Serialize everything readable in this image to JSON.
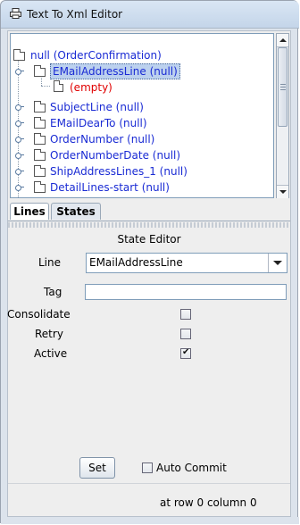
{
  "window": {
    "title": "Text To Xml Editor",
    "icon": "printer-icon"
  },
  "tree": {
    "root_label": "null (OrderConfirmation)",
    "nodes": [
      {
        "label": "EMailAddressLine (null)",
        "selected": true,
        "icon": "folder-icon"
      },
      {
        "label": "(empty)",
        "icon": "document-icon",
        "color": "#e00000"
      },
      {
        "label": "SubjectLine (null)",
        "icon": "folder-icon"
      },
      {
        "label": "EMailDearTo (null)",
        "icon": "folder-icon"
      },
      {
        "label": "OrderNumber (null)",
        "icon": "folder-icon"
      },
      {
        "label": "OrderNumberDate (null)",
        "icon": "folder-icon"
      },
      {
        "label": "ShipAddressLines_1 (null)",
        "icon": "folder-icon"
      },
      {
        "label": "DetailLines-start (null)",
        "icon": "folder-icon"
      }
    ]
  },
  "tabs": [
    {
      "label": "Lines",
      "active": true
    },
    {
      "label": "States",
      "active": false
    }
  ],
  "state_editor": {
    "title": "State Editor",
    "line_label": "Line",
    "line_value": "EMailAddressLine",
    "tag_label": "Tag",
    "tag_value": "",
    "consolidate_label": "Consolidate",
    "consolidate_checked": false,
    "retry_label": "Retry",
    "retry_checked": false,
    "active_label": "Active",
    "active_checked": true
  },
  "actions": {
    "set_label": "Set",
    "auto_commit_label": "Auto Commit",
    "auto_commit_checked": false
  },
  "status": {
    "text": "at row 0 column 0"
  },
  "colors": {
    "selection": "#bcd1ee",
    "tree_text": "#1a2bd4",
    "empty_text": "#e00000"
  }
}
